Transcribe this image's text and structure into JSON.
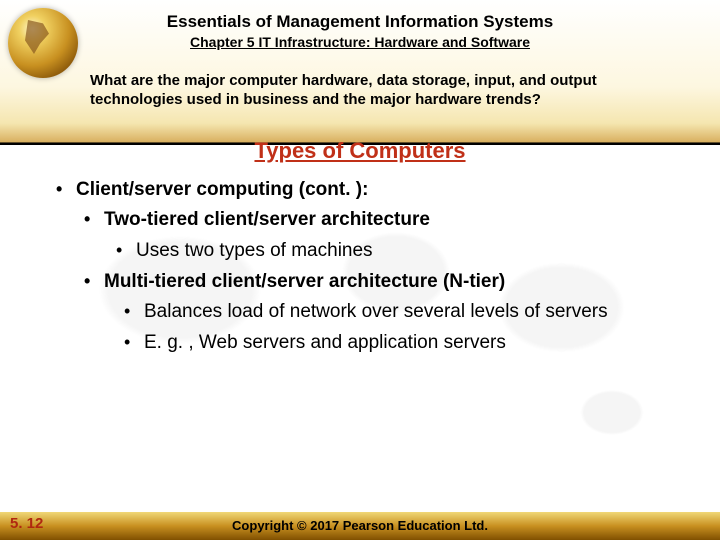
{
  "header": {
    "title": "Essentials of Management Information Systems",
    "chapter": "Chapter 5 IT Infrastructure: Hardware and Software",
    "question": "What are the major computer hardware, data storage, input, and output technologies used in business and the major hardware trends?"
  },
  "section_title": "Types of Computers",
  "bullets": {
    "main": "Client/server computing (cont. ):",
    "two_tier": "Two-tiered client/server architecture",
    "two_tier_sub": "Uses two types of machines",
    "multi_tier": "Multi-tiered client/server architecture (N-tier)",
    "multi_sub1": "Balances load of network over several levels of servers",
    "multi_sub2": "E. g. , Web servers and application servers"
  },
  "footer": {
    "copyright": "Copyright © 2017 Pearson Education Ltd.",
    "slide_number": "5. 12"
  }
}
